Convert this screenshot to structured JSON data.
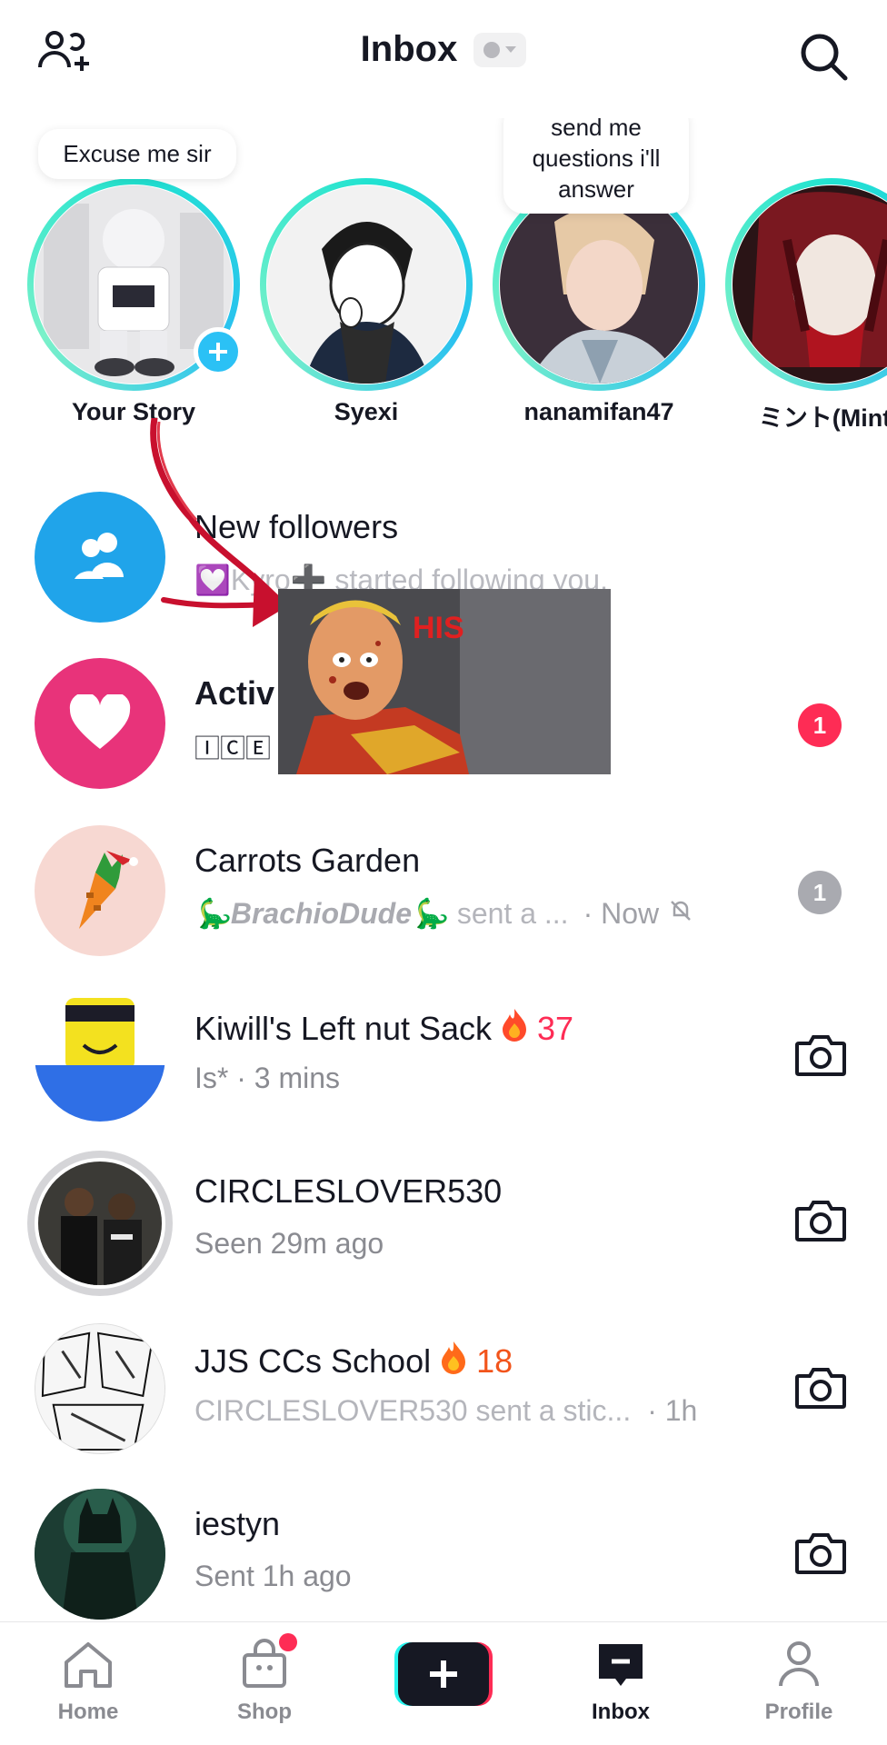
{
  "header": {
    "title": "Inbox"
  },
  "stories": [
    {
      "name": "Your Story",
      "bubble": "Excuse me sir"
    },
    {
      "name": "Syexi",
      "bubble": ""
    },
    {
      "name": "nanamifan47",
      "bubble": "send me\nquestions i'll\nanswer"
    },
    {
      "name": "ミント(Mintv",
      "bubble": ""
    }
  ],
  "rows": {
    "new_followers": {
      "title": "New followers",
      "subtitle": "💟Kyro➕ started following you."
    },
    "activity": {
      "title": "Activ",
      "subtitle": "🄸🄲🄴",
      "badge": "1"
    },
    "carrots": {
      "title": "Carrots Garden",
      "sender": "🦕BrachioDude🦕",
      "preview": "sent a ...",
      "time": "· Now",
      "badge": "1"
    },
    "kiwill": {
      "title": "Kiwill's Left nut Sack",
      "streak": "37",
      "subtitle": "Is* · 3 mins"
    },
    "circles": {
      "title": "CIRCLESLOVER530",
      "subtitle": "Seen 29m ago"
    },
    "jjs": {
      "title": "JJS CCs School",
      "streak": "18",
      "subtitle": "CIRCLESLOVER530 sent a stic...",
      "time": "· 1h"
    },
    "iestyn": {
      "title": "iestyn",
      "subtitle": "Sent 1h ago"
    }
  },
  "overlay": {
    "text": "HIS"
  },
  "nav": {
    "home": "Home",
    "shop": "Shop",
    "inbox": "Inbox",
    "profile": "Profile"
  },
  "colors": {
    "accent_pink": "#fe2c55",
    "accent_blue": "#2bc1f5",
    "muted": "#8a8b91"
  }
}
